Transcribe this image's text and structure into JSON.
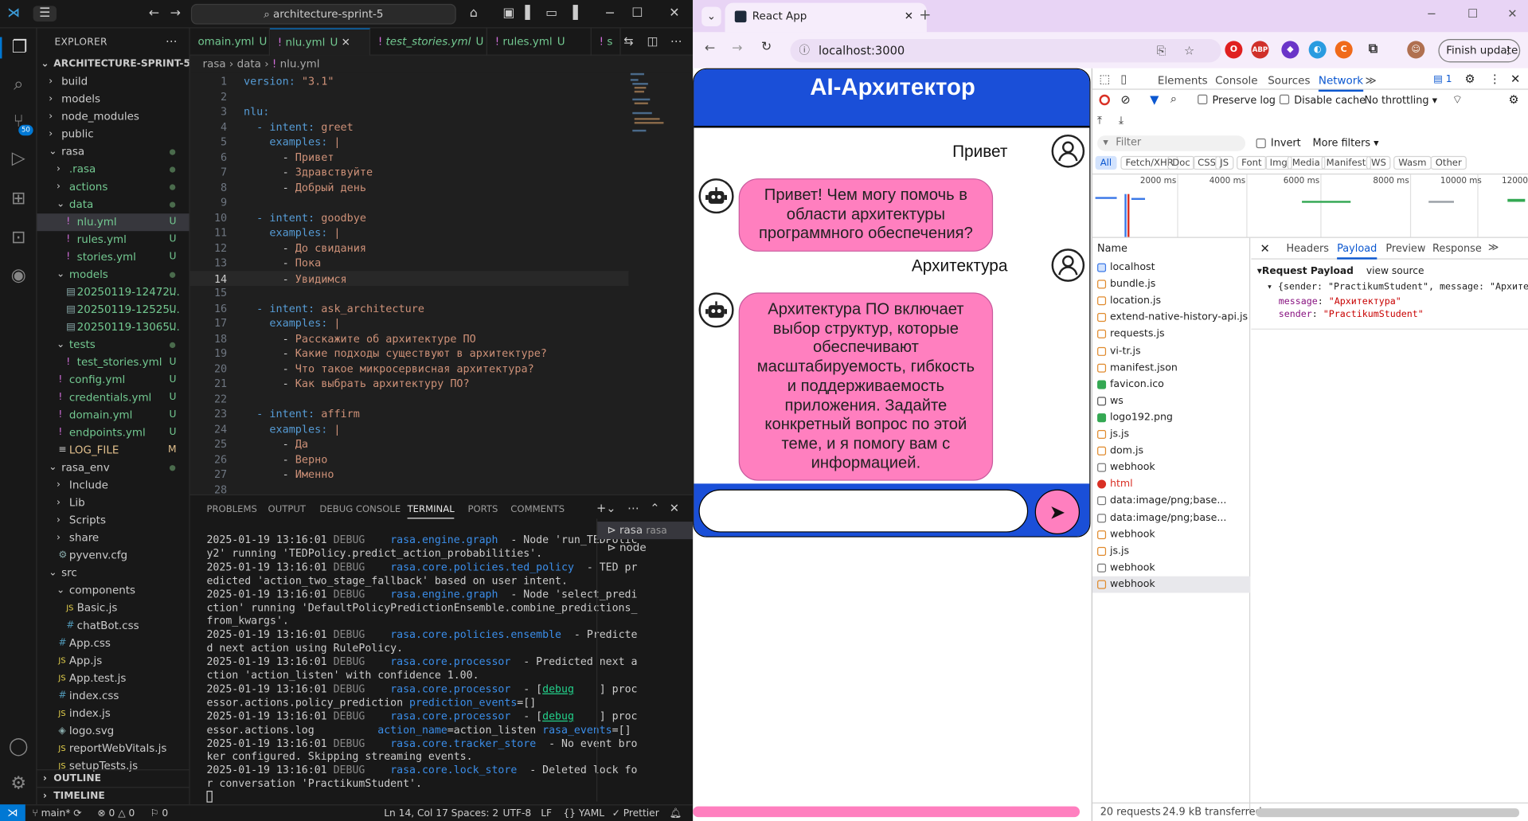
{
  "vscode": {
    "search": "architecture-sprint-5",
    "explorer_title": "EXPLORER",
    "project": "ARCHITECTURE-SPRINT-5",
    "tree": [
      {
        "label": "build",
        "indent": 1,
        "chev": "›",
        "color": "w"
      },
      {
        "label": "models",
        "indent": 1,
        "chev": "›",
        "color": "w"
      },
      {
        "label": "node_modules",
        "indent": 1,
        "chev": "›",
        "color": "w"
      },
      {
        "label": "public",
        "indent": 1,
        "chev": "›",
        "color": "w"
      },
      {
        "label": "rasa",
        "indent": 1,
        "chev": "⌄",
        "color": "w",
        "dot": true
      },
      {
        "label": ".rasa",
        "indent": 2,
        "chev": "›",
        "color": "g",
        "dot": true
      },
      {
        "label": "actions",
        "indent": 2,
        "chev": "›",
        "color": "g",
        "dot": true
      },
      {
        "label": "data",
        "indent": 2,
        "chev": "⌄",
        "color": "g",
        "dot": true
      },
      {
        "label": "nlu.yml",
        "indent": 3,
        "icon": "!",
        "color": "g",
        "status": "U",
        "sel": true
      },
      {
        "label": "rules.yml",
        "indent": 3,
        "icon": "!",
        "color": "g",
        "status": "U"
      },
      {
        "label": "stories.yml",
        "indent": 3,
        "icon": "!",
        "color": "g",
        "status": "U"
      },
      {
        "label": "models",
        "indent": 2,
        "chev": "⌄",
        "color": "g",
        "dot": true
      },
      {
        "label": "20250119-12472...",
        "indent": 3,
        "icon": "▤",
        "color": "g",
        "status": "U"
      },
      {
        "label": "20250119-12525...",
        "indent": 3,
        "icon": "▤",
        "color": "g",
        "status": "U"
      },
      {
        "label": "20250119-13065...",
        "indent": 3,
        "icon": "▤",
        "color": "g",
        "status": "U"
      },
      {
        "label": "tests",
        "indent": 2,
        "chev": "⌄",
        "color": "g",
        "dot": true
      },
      {
        "label": "test_stories.yml",
        "indent": 3,
        "icon": "!",
        "color": "g",
        "status": "U"
      },
      {
        "label": "config.yml",
        "indent": 2,
        "icon": "!",
        "color": "g",
        "status": "U"
      },
      {
        "label": "credentials.yml",
        "indent": 2,
        "icon": "!",
        "color": "g",
        "status": "U"
      },
      {
        "label": "domain.yml",
        "indent": 2,
        "icon": "!",
        "color": "g",
        "status": "U"
      },
      {
        "label": "endpoints.yml",
        "indent": 2,
        "icon": "!",
        "color": "g",
        "status": "U"
      },
      {
        "label": "LOG_FILE",
        "indent": 2,
        "icon": "≡",
        "color": "y",
        "status": "M"
      },
      {
        "label": "rasa_env",
        "indent": 1,
        "chev": "⌄",
        "color": "w",
        "dot": true
      },
      {
        "label": "Include",
        "indent": 2,
        "chev": "›",
        "color": "w"
      },
      {
        "label": "Lib",
        "indent": 2,
        "chev": "›",
        "color": "w"
      },
      {
        "label": "Scripts",
        "indent": 2,
        "chev": "›",
        "color": "w"
      },
      {
        "label": "share",
        "indent": 2,
        "chev": "›",
        "color": "w"
      },
      {
        "label": "pyvenv.cfg",
        "indent": 2,
        "icon": "⚙",
        "color": "w"
      },
      {
        "label": "src",
        "indent": 1,
        "chev": "⌄",
        "color": "w"
      },
      {
        "label": "components",
        "indent": 2,
        "chev": "⌄",
        "color": "w"
      },
      {
        "label": "Basic.js",
        "indent": 3,
        "icon": "JS",
        "color": "w"
      },
      {
        "label": "chatBot.css",
        "indent": 3,
        "icon": "#",
        "color": "w"
      },
      {
        "label": "App.css",
        "indent": 2,
        "icon": "#",
        "color": "w"
      },
      {
        "label": "App.js",
        "indent": 2,
        "icon": "JS",
        "color": "w"
      },
      {
        "label": "App.test.js",
        "indent": 2,
        "icon": "JS",
        "color": "w"
      },
      {
        "label": "index.css",
        "indent": 2,
        "icon": "#",
        "color": "w"
      },
      {
        "label": "index.js",
        "indent": 2,
        "icon": "JS",
        "color": "w"
      },
      {
        "label": "logo.svg",
        "indent": 2,
        "icon": "◈",
        "color": "w"
      },
      {
        "label": "reportWebVitals.js",
        "indent": 2,
        "icon": "JS",
        "color": "w"
      },
      {
        "label": "setupTests.js",
        "indent": 2,
        "icon": "JS",
        "color": "w"
      }
    ],
    "outline": "OUTLINE",
    "timeline": "TIMELINE",
    "tabs": [
      {
        "label": "omain.yml",
        "status": "U",
        "italic": false
      },
      {
        "label": "nlu.yml",
        "status": "U",
        "active": true
      },
      {
        "label": "test_stories.yml",
        "status": "U",
        "italic": true
      },
      {
        "label": "rules.yml",
        "status": "U"
      },
      {
        "label": "s",
        "status": ""
      }
    ],
    "breadcrumb": [
      "rasa",
      "data",
      "nlu.yml"
    ],
    "code": [
      [
        "version: ",
        "\"3.1\""
      ],
      [
        "",
        ""
      ],
      [
        "nlu:",
        ""
      ],
      [
        "  - intent: ",
        "greet"
      ],
      [
        "    examples: ",
        "|"
      ],
      [
        "      - ",
        "Привет"
      ],
      [
        "      - ",
        "Здравствуйте"
      ],
      [
        "      - ",
        "Добрый день"
      ],
      [
        "",
        ""
      ],
      [
        "  - intent: ",
        "goodbye"
      ],
      [
        "    examples: ",
        "|"
      ],
      [
        "      - ",
        "До свидания"
      ],
      [
        "      - ",
        "Пока"
      ],
      [
        "      - ",
        "Увидимся"
      ],
      [
        "",
        ""
      ],
      [
        "  - intent: ",
        "ask_architecture"
      ],
      [
        "    examples: ",
        "|"
      ],
      [
        "      - ",
        "Расскажите об архитектуре ПО"
      ],
      [
        "      - ",
        "Какие подходы существуют в архитектуре?"
      ],
      [
        "      - ",
        "Что такое микросервисная архитектура?"
      ],
      [
        "      - ",
        "Как выбрать архитектуру ПО?"
      ],
      [
        "",
        ""
      ],
      [
        "  - intent: ",
        "affirm"
      ],
      [
        "    examples: ",
        "|"
      ],
      [
        "      - ",
        "Да"
      ],
      [
        "      - ",
        "Верно"
      ],
      [
        "      - ",
        "Именно"
      ],
      [
        "",
        ""
      ]
    ],
    "panel_tabs": [
      "PROBLEMS",
      "OUTPUT",
      "DEBUG CONSOLE",
      "TERMINAL",
      "PORTS",
      "COMMENTS"
    ],
    "terminal": [
      [
        [
          "2025-01-19 13:16:01 ",
          "t"
        ],
        [
          "DEBUG",
          "d"
        ],
        [
          "    rasa.engine.graph",
          "l"
        ],
        [
          "  - Node 'run_TEDPolic",
          "t"
        ]
      ],
      [
        [
          "y2' running 'TEDPolicy.predict_action_probabilities'.",
          "t"
        ]
      ],
      [
        [
          "2025-01-19 13:16:01 ",
          "t"
        ],
        [
          "DEBUG",
          "d"
        ],
        [
          "    rasa.core.policies.ted_policy",
          "l"
        ],
        [
          "  - TED pr",
          "t"
        ]
      ],
      [
        [
          "edicted 'action_two_stage_fallback' based on user intent.",
          "t"
        ]
      ],
      [
        [
          "2025-01-19 13:16:01 ",
          "t"
        ],
        [
          "DEBUG",
          "d"
        ],
        [
          "    rasa.engine.graph",
          "l"
        ],
        [
          "  - Node 'select_predi",
          "t"
        ]
      ],
      [
        [
          "ction' running 'DefaultPolicyPredictionEnsemble.combine_predictions_",
          "t"
        ]
      ],
      [
        [
          "from_kwargs'.",
          "t"
        ]
      ],
      [
        [
          "2025-01-19 13:16:01 ",
          "t"
        ],
        [
          "DEBUG",
          "d"
        ],
        [
          "    rasa.core.policies.ensemble",
          "l"
        ],
        [
          "  - Predicte",
          "t"
        ]
      ],
      [
        [
          "d next action using RulePolicy.",
          "t"
        ]
      ],
      [
        [
          "2025-01-19 13:16:01 ",
          "t"
        ],
        [
          "DEBUG",
          "d"
        ],
        [
          "    rasa.core.processor",
          "l"
        ],
        [
          "  - Predicted next a",
          "t"
        ]
      ],
      [
        [
          "ction 'action_listen' with confidence 1.00.",
          "t"
        ]
      ],
      [
        [
          "2025-01-19 13:16:01 ",
          "t"
        ],
        [
          "DEBUG",
          "d"
        ],
        [
          "    rasa.core.processor",
          "l"
        ],
        [
          "  - [",
          "t"
        ],
        [
          "debug",
          "g"
        ],
        [
          "    ] proc",
          "t"
        ]
      ],
      [
        [
          "essor.actions.policy_prediction ",
          "t"
        ],
        [
          "prediction_events",
          "l"
        ],
        [
          "=[]",
          "t"
        ]
      ],
      [
        [
          "2025-01-19 13:16:01 ",
          "t"
        ],
        [
          "DEBUG",
          "d"
        ],
        [
          "    rasa.core.processor",
          "l"
        ],
        [
          "  - [",
          "t"
        ],
        [
          "debug",
          "g"
        ],
        [
          "    ] proc",
          "t"
        ]
      ],
      [
        [
          "essor.actions.log          ",
          "t"
        ],
        [
          "action_name",
          "l"
        ],
        [
          "=action_listen ",
          "t"
        ],
        [
          "rasa_events",
          "l"
        ],
        [
          "=[]",
          "t"
        ]
      ],
      [
        [
          "2025-01-19 13:16:01 ",
          "t"
        ],
        [
          "DEBUG",
          "d"
        ],
        [
          "    rasa.core.tracker_store",
          "l"
        ],
        [
          "  - No event bro",
          "t"
        ]
      ],
      [
        [
          "ker configured. Skipping streaming events.",
          "t"
        ]
      ],
      [
        [
          "2025-01-19 13:16:01 ",
          "t"
        ],
        [
          "DEBUG",
          "d"
        ],
        [
          "    rasa.core.lock_store",
          "l"
        ],
        [
          "  - Deleted lock fo",
          "t"
        ]
      ],
      [
        [
          "r conversation 'PractikumStudent'.",
          "t"
        ]
      ]
    ],
    "terminal_list": [
      {
        "label": "rasa",
        "sub": "rasa"
      },
      {
        "label": "node",
        "sub": ""
      }
    ],
    "status": {
      "branch": "main*",
      "errors": "0",
      "warnings": "0",
      "ports": "0",
      "position": "Ln 14, Col 17",
      "spaces": "Spaces: 2",
      "encoding": "UTF-8",
      "eol": "LF",
      "lang": "YAML",
      "formatter": "Prettier"
    },
    "badge_source": "50"
  },
  "chrome": {
    "tab_title": "React App",
    "url": "localhost:3000",
    "update": "Finish update"
  },
  "app": {
    "title": "AI-Архитектор",
    "messages": [
      {
        "from": "user",
        "text": "Привет"
      },
      {
        "from": "bot",
        "text": "Привет! Чем могу помочь в области архитектуры программного обеспечения?"
      },
      {
        "from": "user",
        "text": "Архитектура"
      },
      {
        "from": "bot",
        "text": "Архитектура ПО включает выбор структур, которые обеспечивают масштабируемость, гибкость и поддерживаемость приложения. Задайте конкретный вопрос по этой теме, и я помогу вам с информацией."
      }
    ],
    "send_icon": "➤"
  },
  "devtools": {
    "tabs": [
      "Elements",
      "Console",
      "Sources",
      "Network"
    ],
    "issues": "1",
    "preserve_log": "Preserve log",
    "disable_cache": "Disable cache",
    "throttling": "No throttling",
    "filter_placeholder": "Filter",
    "invert": "Invert",
    "more_filters": "More filters",
    "chips": [
      "All",
      "Fetch/XHR",
      "Doc",
      "CSS",
      "JS",
      "Font",
      "Img",
      "Media",
      "Manifest",
      "WS",
      "Wasm",
      "Other"
    ],
    "timeline_ticks": [
      "2000 ms",
      "4000 ms",
      "6000 ms",
      "8000 ms",
      "10000 ms",
      "12000"
    ],
    "name_header": "Name",
    "requests": [
      {
        "name": "localhost",
        "type": "doc"
      },
      {
        "name": "bundle.js",
        "type": "js"
      },
      {
        "name": "location.js",
        "type": "js"
      },
      {
        "name": "extend-native-history-api.js",
        "type": "js"
      },
      {
        "name": "requests.js",
        "type": "js"
      },
      {
        "name": "vi-tr.js",
        "type": "js"
      },
      {
        "name": "manifest.json",
        "type": "js"
      },
      {
        "name": "favicon.ico",
        "type": "img"
      },
      {
        "name": "ws",
        "type": "ws"
      },
      {
        "name": "logo192.png",
        "type": "img"
      },
      {
        "name": "js.js",
        "type": "js"
      },
      {
        "name": "dom.js",
        "type": "js"
      },
      {
        "name": "webhook",
        "type": "other"
      },
      {
        "name": "html",
        "type": "error"
      },
      {
        "name": "data:image/png;base...",
        "type": "other"
      },
      {
        "name": "data:image/png;base...",
        "type": "other"
      },
      {
        "name": "webhook",
        "type": "fetch"
      },
      {
        "name": "js.js",
        "type": "js"
      },
      {
        "name": "webhook",
        "type": "other"
      },
      {
        "name": "webhook",
        "type": "fetch"
      }
    ],
    "detail_tabs": [
      "Headers",
      "Payload",
      "Preview",
      "Response"
    ],
    "payload_title": "Request Payload",
    "view_source": "view source",
    "payload_summary": "{sender: \"PractikumStudent\", message: \"Архитекту",
    "payload_fields": [
      {
        "key": "message",
        "value": "\"Архитектура\""
      },
      {
        "key": "sender",
        "value": "\"PractikumStudent\""
      }
    ],
    "summary_requests": "20 requests",
    "summary_transferred": "24.9 kB transferred"
  }
}
